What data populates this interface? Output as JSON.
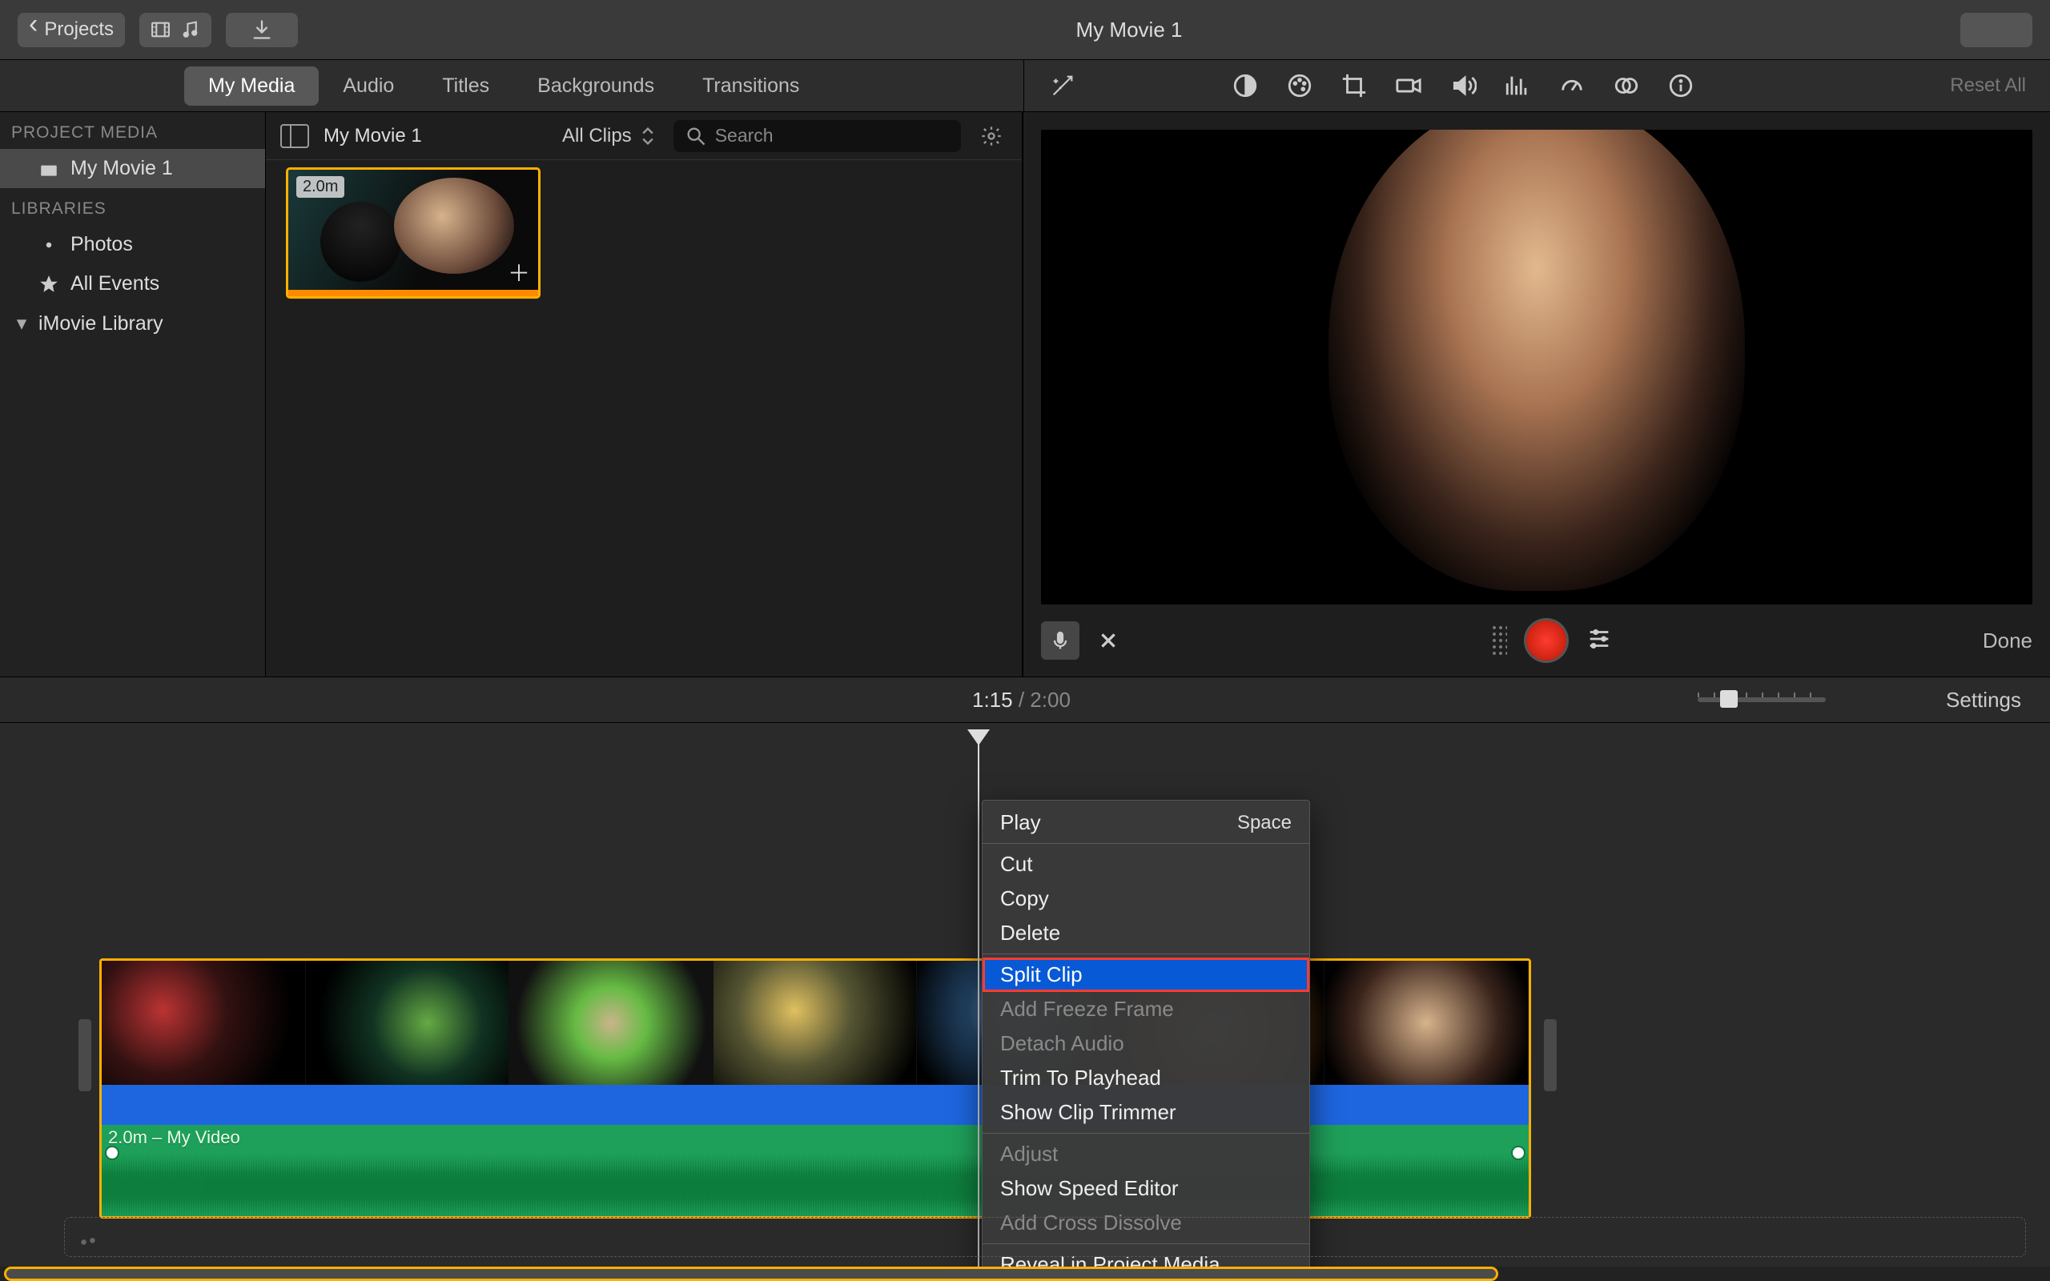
{
  "topbar": {
    "projects_label": "Projects",
    "title": "My Movie 1"
  },
  "tabs": {
    "items": [
      "My Media",
      "Audio",
      "Titles",
      "Backgrounds",
      "Transitions"
    ],
    "active_index": 0,
    "reset_label": "Reset All"
  },
  "sidebar": {
    "project_media_label": "PROJECT MEDIA",
    "project_name": "My Movie 1",
    "libraries_label": "LIBRARIES",
    "photos_label": "Photos",
    "all_events_label": "All Events",
    "imovie_library_label": "iMovie Library"
  },
  "library": {
    "name": "My Movie 1",
    "filter_label": "All Clips",
    "search_placeholder": "Search",
    "clip_duration": "2.0m"
  },
  "viewer": {
    "done_label": "Done"
  },
  "timeline": {
    "current_time": "1:15",
    "total_time": "2:00",
    "settings_label": "Settings",
    "audio_clip_label": "2.0m – My Video"
  },
  "context_menu": {
    "play": "Play",
    "play_shortcut": "Space",
    "cut": "Cut",
    "copy": "Copy",
    "delete": "Delete",
    "split_clip": "Split Clip",
    "add_freeze_frame": "Add Freeze Frame",
    "detach_audio": "Detach Audio",
    "trim_to_playhead": "Trim To Playhead",
    "show_clip_trimmer": "Show Clip Trimmer",
    "adjust": "Adjust",
    "show_speed_editor": "Show Speed Editor",
    "add_cross_dissolve": "Add Cross Dissolve",
    "reveal_in_project_media": "Reveal in Project Media"
  }
}
